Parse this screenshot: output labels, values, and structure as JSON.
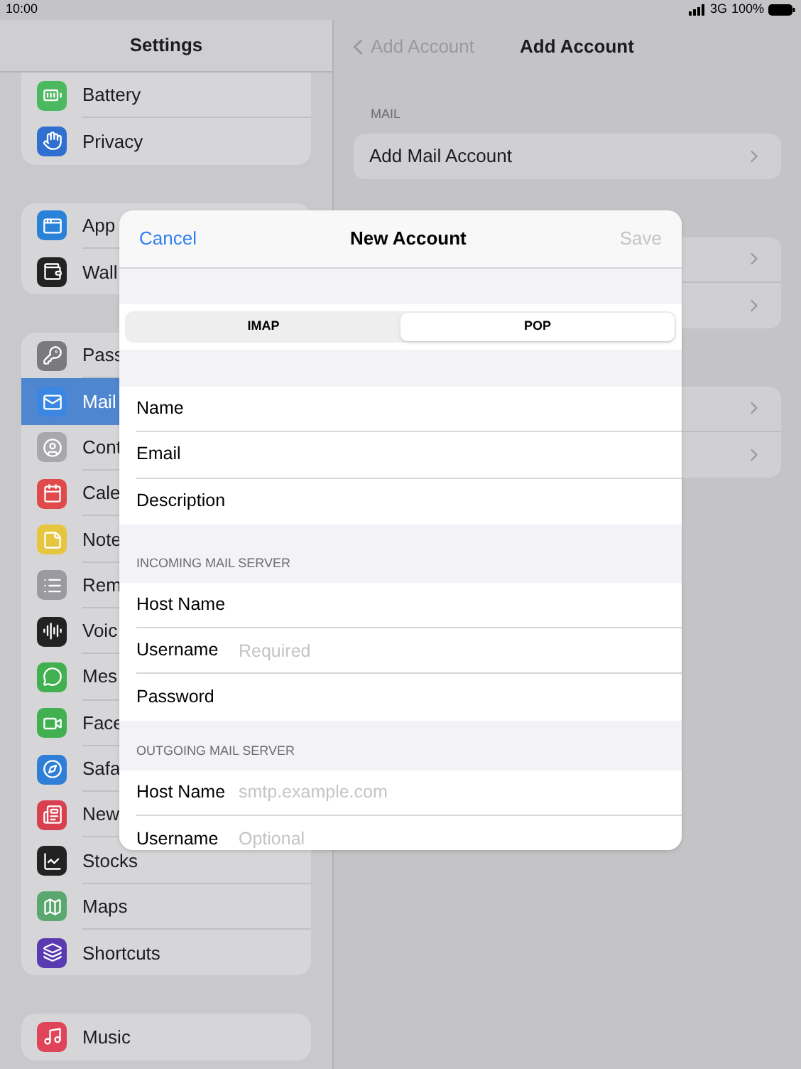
{
  "status_bar": {
    "time": "10:00",
    "network": "3G",
    "battery": "100%"
  },
  "sidebar": {
    "title": "Settings",
    "groups": [
      {
        "items": [
          {
            "label": "Battery",
            "selected": false
          },
          {
            "label": "Privacy",
            "selected": false
          }
        ]
      },
      {
        "items": [
          {
            "label": "App",
            "selected": false
          },
          {
            "label": "Wall",
            "selected": false
          }
        ]
      },
      {
        "items": [
          {
            "label": "Pass",
            "selected": false
          },
          {
            "label": "Mail",
            "selected": true
          },
          {
            "label": "Cont",
            "selected": false
          },
          {
            "label": "Cale",
            "selected": false
          },
          {
            "label": "Note",
            "selected": false
          },
          {
            "label": "Rem",
            "selected": false
          },
          {
            "label": "Voic",
            "selected": false
          },
          {
            "label": "Mes",
            "selected": false
          },
          {
            "label": "Face",
            "selected": false
          },
          {
            "label": "Safa",
            "selected": false
          },
          {
            "label": "New",
            "selected": false
          },
          {
            "label": "Stocks",
            "selected": false
          },
          {
            "label": "Maps",
            "selected": false
          },
          {
            "label": "Shortcuts",
            "selected": false
          }
        ]
      },
      {
        "items": [
          {
            "label": "Music",
            "selected": false
          }
        ]
      }
    ]
  },
  "detail": {
    "back": "Add Account",
    "title": "Add Account",
    "sections": [
      {
        "header": "MAIL",
        "rows": [
          {
            "label": "Add Mail Account",
            "chevron": true
          }
        ]
      },
      {
        "rows": [
          {
            "chevron": true
          },
          {
            "chevron": true
          }
        ]
      },
      {
        "rows": [
          {
            "chevron": true
          },
          {
            "chevron": true
          }
        ]
      }
    ]
  },
  "dialog": {
    "cancel": "Cancel",
    "title": "New Account",
    "save": {
      "label": "Save",
      "disabled": true
    },
    "segments": [
      {
        "label": "IMAP",
        "selected": false
      },
      {
        "label": "POP",
        "selected": true
      }
    ],
    "sections": [
      {
        "fields": [
          {
            "label": "Name"
          },
          {
            "label": "Email"
          },
          {
            "label": "Description"
          }
        ]
      },
      {
        "header": "INCOMING MAIL SERVER",
        "fields": [
          {
            "label": "Host Name"
          },
          {
            "label": "Username",
            "placeholder": "Required"
          },
          {
            "label": "Password"
          }
        ]
      },
      {
        "header": "OUTGOING MAIL SERVER",
        "fields": [
          {
            "label": "Host Name",
            "placeholder": "smtp.example.com"
          },
          {
            "label": "Username",
            "placeholder": "Optional"
          }
        ]
      }
    ]
  }
}
